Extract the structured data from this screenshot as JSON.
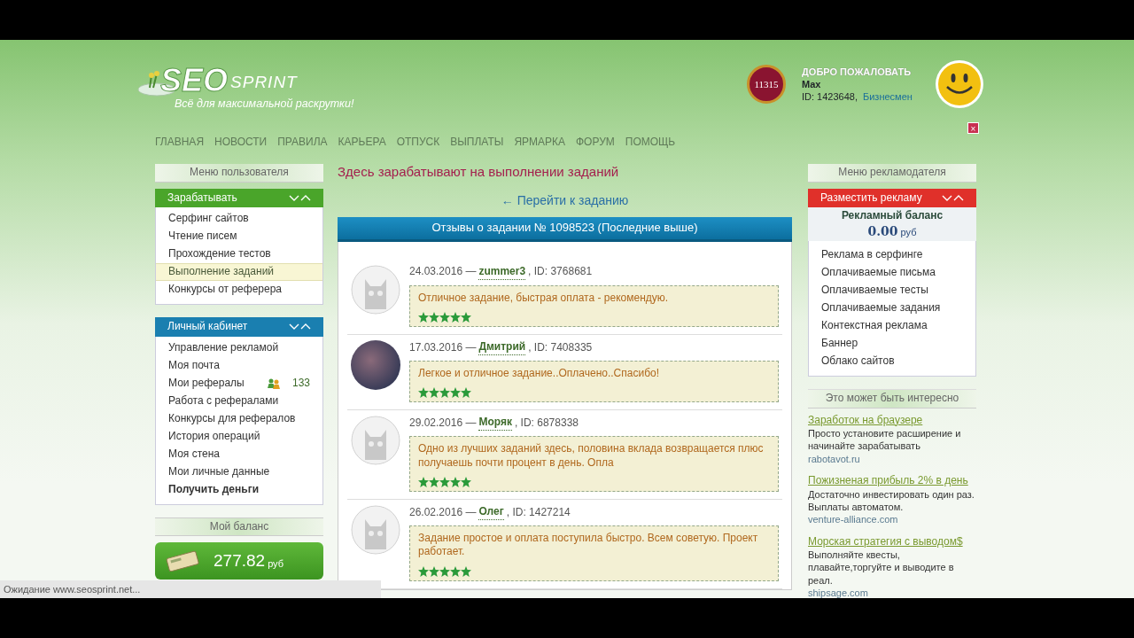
{
  "header": {
    "logo": {
      "big": "SEO",
      "small": "SPRINT",
      "tagline": "Всё для максимальной раскрутки!"
    },
    "rating_badge": "11315",
    "close_button": "×",
    "welcome": {
      "title": "ДОБРО ПОЖАЛОВАТЬ",
      "username": "Max",
      "id": "ID: 1423648,",
      "status": "Бизнесмен"
    }
  },
  "nav": [
    "ГЛАВНАЯ",
    "НОВОСТИ",
    "ПРАВИЛА",
    "КАРЬЕРА",
    "ОТПУСК",
    "ВЫПЛАТЫ",
    "ЯРМАРКА",
    "ФОРУМ",
    "ПОМОЩЬ"
  ],
  "left_sidebar": {
    "title": "Меню пользователя",
    "sections": [
      {
        "title": "Зарабатывать",
        "color": "#4aa52a",
        "items": [
          {
            "label": "Серфинг сайтов",
            "selected": false,
            "bold": false
          },
          {
            "label": "Чтение писем",
            "selected": false,
            "bold": false
          },
          {
            "label": "Прохождение тестов",
            "selected": false,
            "bold": false
          },
          {
            "label": "Выполнение заданий",
            "selected": true,
            "bold": false
          },
          {
            "label": "Конкурсы от реферера",
            "selected": false,
            "bold": false
          }
        ]
      },
      {
        "title": "Личный кабинет",
        "color": "#1a7fb0",
        "items": [
          {
            "label": "Управление рекламой",
            "selected": false,
            "bold": false
          },
          {
            "label": "Моя почта",
            "selected": false,
            "bold": false
          },
          {
            "label": "Мои рефералы",
            "selected": false,
            "bold": false,
            "count": "133"
          },
          {
            "label": "Работа с рефералами",
            "selected": false,
            "bold": false
          },
          {
            "label": "Конкурсы для рефералов",
            "selected": false,
            "bold": false
          },
          {
            "label": "История операций",
            "selected": false,
            "bold": false
          },
          {
            "label": "Моя стена",
            "selected": false,
            "bold": false
          },
          {
            "label": "Мои личные данные",
            "selected": false,
            "bold": false
          },
          {
            "label": "Получить деньги",
            "selected": false,
            "bold": true
          }
        ]
      }
    ],
    "balance": {
      "title": "Мой баланс",
      "amount": "277.82",
      "currency": "руб"
    }
  },
  "main": {
    "title": "Здесь зарабатывают на выполнении заданий",
    "back_link": "← Перейти к заданию",
    "panel_title": "Отзывы о задании № 1098523 (Последние выше)",
    "reviews": [
      {
        "date": "24.03.2016 —",
        "author": "zummer3",
        "id": ", ID: 3768681",
        "text": "Отличное задание, быстрая оплата - рекомендую.",
        "stars": 5,
        "kind": "default"
      },
      {
        "date": "17.03.2016 —",
        "author": "Дмитрий",
        "id": ", ID: 7408335",
        "text": "Легкое и отличное задание..Оплачено..Спасибо!",
        "stars": 5,
        "kind": "photo"
      },
      {
        "date": "29.02.2016 —",
        "author": "Моряк",
        "id": ", ID: 6878338",
        "text": "Одно из лучших заданий здесь, половина вклада возвращается плюс получаешь почти процент в день. Опла",
        "stars": 5,
        "kind": "default"
      },
      {
        "date": "26.02.2016 —",
        "author": "Олег",
        "id": ", ID: 1427214",
        "text": "Задание простое и оплата поступила быстро. Всем советую. Проект работает.",
        "stars": 5,
        "kind": "default"
      }
    ]
  },
  "right_sidebar": {
    "title": "Меню рекламодателя",
    "section": {
      "title": "Разместить рекламу",
      "color": "#e0302a",
      "balance_label": "Рекламный баланс",
      "balance": "0.00",
      "currency": "руб",
      "items": [
        "Реклама в серфинге",
        "Оплачиваемые письма",
        "Оплачиваемые тесты",
        "Оплачиваемые задания",
        "Контекстная реклама",
        "Баннер",
        "Облако сайтов"
      ]
    },
    "ads_title": "Это может быть интересно",
    "ads": [
      {
        "title": "Заработок на браузере",
        "text": "Просто установите расширение и начинайте зарабатывать",
        "domain": "rabotavot.ru"
      },
      {
        "title": "Пожизненая прибыль 2% в день",
        "text": "Достаточно инвестировать один раз. Выплаты автоматом.",
        "domain": "venture-alliance.com"
      },
      {
        "title": "Морская стратегия с выводом$",
        "text": "Выполняйте квесты, плавайте,торгуйте и выводите в реал.",
        "domain": "shipsage.com"
      }
    ]
  },
  "status_bar": "Ожидание www.seosprint.net..."
}
